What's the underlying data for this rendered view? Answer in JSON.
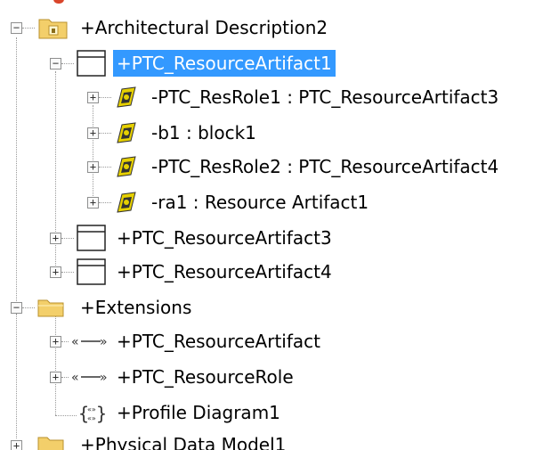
{
  "tree": {
    "architectural_description": {
      "label": "+Architectural Description2",
      "icon": "folder-package-icon",
      "expanded": true
    },
    "resource_artifact1": {
      "label": "+PTC_ResourceArtifact1",
      "icon": "class-box-icon",
      "selected": true,
      "expanded": true
    },
    "part1": {
      "label": "-PTC_ResRole1 : PTC_ResourceArtifact3",
      "icon": "part-property-icon"
    },
    "part2": {
      "label": "-b1 : block1",
      "icon": "part-property-icon"
    },
    "part3": {
      "label": "-PTC_ResRole2 : PTC_ResourceArtifact4",
      "icon": "part-property-icon"
    },
    "part4": {
      "label": "-ra1 : Resource Artifact1",
      "icon": "part-property-icon"
    },
    "resource_artifact3": {
      "label": "+PTC_ResourceArtifact3",
      "icon": "class-box-icon"
    },
    "resource_artifact4": {
      "label": "+PTC_ResourceArtifact4",
      "icon": "class-box-icon"
    },
    "extensions": {
      "label": "+Extensions",
      "icon": "folder-icon",
      "expanded": true
    },
    "stereo1": {
      "label": "+PTC_ResourceArtifact",
      "icon": "stereotype-icon"
    },
    "stereo2": {
      "label": "+PTC_ResourceRole",
      "icon": "stereotype-icon"
    },
    "profile_diagram": {
      "label": "+Profile Diagram1",
      "icon": "profile-diagram-icon"
    },
    "physical_data_model": {
      "label": "+Physical Data Model1",
      "icon": "folder-icon"
    }
  },
  "colors": {
    "selection": "#3399ff",
    "folder": "#f3cf6a",
    "connector": "#9a9a9a"
  }
}
